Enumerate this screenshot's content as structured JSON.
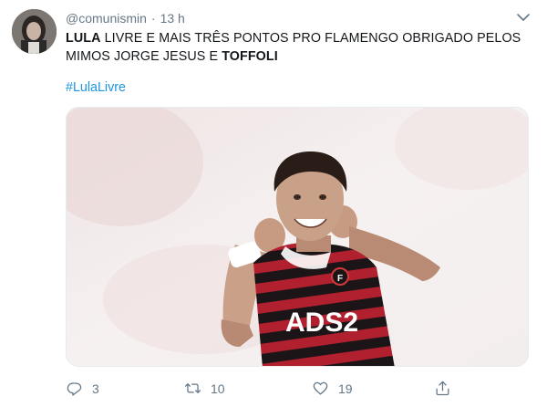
{
  "tweet": {
    "handle": "@comunismin",
    "separator": "·",
    "time": "13 h",
    "text_parts": [
      {
        "text": "LULA",
        "bold": true
      },
      {
        "text": " LIVRE E MAIS TRÊS PONTOS PRO FLAMENGO OBRIGADO PELOS MIMOS JORGE JESUS E ",
        "bold": false
      },
      {
        "text": "TOFFOLI",
        "bold": true
      }
    ],
    "hashtag": "#LulaLivre",
    "media": {
      "jersey_text": "ADS2"
    },
    "actions": {
      "replies": "3",
      "retweets": "10",
      "likes": "19"
    }
  },
  "icons": {
    "avatar": "profile-photo",
    "caret": "chevron-down-icon",
    "reply": "reply-icon",
    "retweet": "retweet-icon",
    "like": "heart-icon",
    "share": "share-icon"
  },
  "colors": {
    "handle": "#657786",
    "text": "#14171a",
    "hashtag": "#1b95e0",
    "jersey_red": "#b11b2a",
    "jersey_black": "#1a1416"
  }
}
